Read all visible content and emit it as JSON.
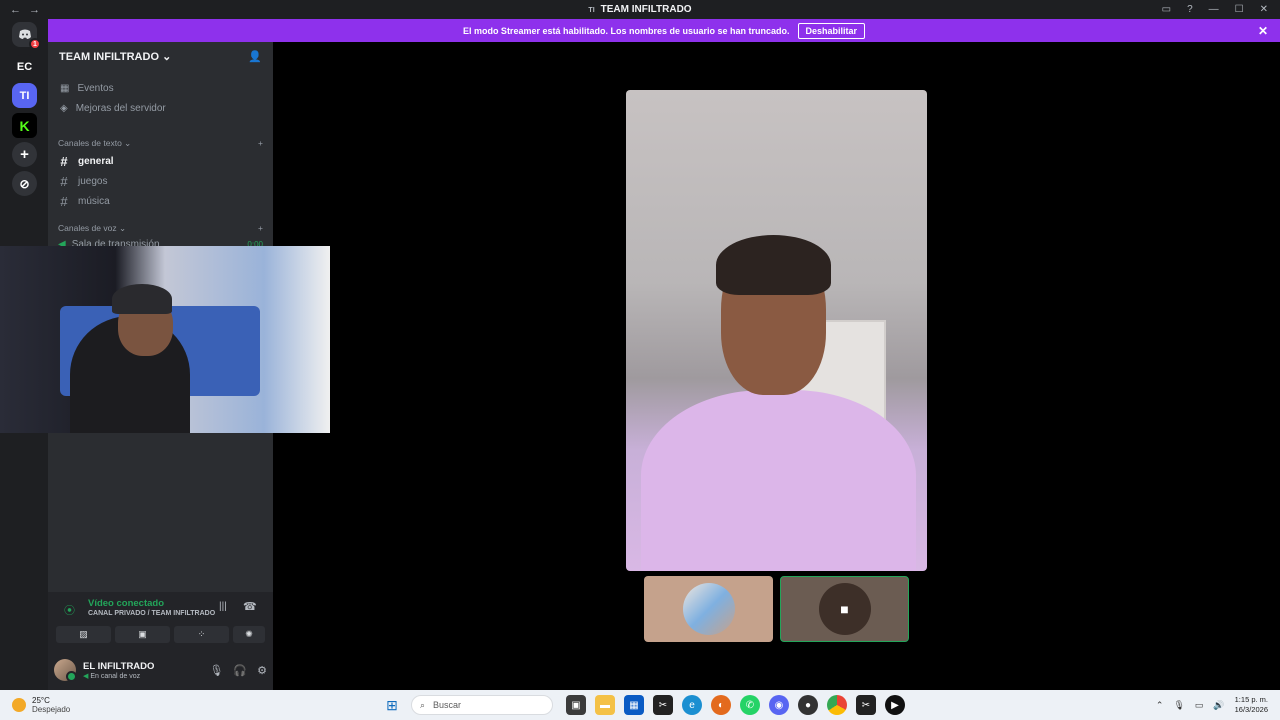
{
  "window": {
    "title": "TEAM INFILTRADO",
    "server_initials": "TI",
    "back_icon": "←",
    "forward_icon": "→"
  },
  "banner": {
    "message": "El modo Streamer está habilitado. Los nombres de usuario se han truncado.",
    "button": "Deshabilitar"
  },
  "guilds": [
    {
      "label": "",
      "icon": "discord-logo",
      "badge": "1"
    },
    {
      "label": "EC"
    },
    {
      "label": "TI"
    },
    {
      "label": "K"
    },
    {
      "label": "+"
    },
    {
      "label": "⊘"
    }
  ],
  "sidebar": {
    "server_name": "TEAM INFILTRADO",
    "menu": [
      {
        "label": "Eventos",
        "icon": "calendar-icon"
      },
      {
        "label": "Mejoras del servidor",
        "icon": "boost-icon"
      }
    ],
    "text_category": "Canales de texto",
    "text_channels": [
      {
        "name": "general",
        "active": true
      },
      {
        "name": "juegos",
        "active": false
      },
      {
        "name": "música",
        "active": false
      }
    ],
    "voice_category": "Canales de voz",
    "voice_channel": {
      "name": "Sala de transmisión",
      "time": "0:00"
    }
  },
  "voice_panel": {
    "status": "Vídeo conectado",
    "channel": "CANAL PRIVADO / TEAM INFILTRADO",
    "buttons": [
      "camera-off-icon",
      "screen-share-icon",
      "activities-icon",
      "soundboard-icon"
    ]
  },
  "user": {
    "name": "EL INFILTRADO",
    "status": "En canal de voz"
  },
  "taskbar": {
    "temperature": "25°C",
    "weather": "Despejado",
    "search_placeholder": "Buscar",
    "time": "1:15 p. m.",
    "date": "16/3/2026"
  },
  "colors": {
    "banner": "#8e31ec",
    "connected": "#23a55a",
    "sidebar": "#2b2d31"
  }
}
